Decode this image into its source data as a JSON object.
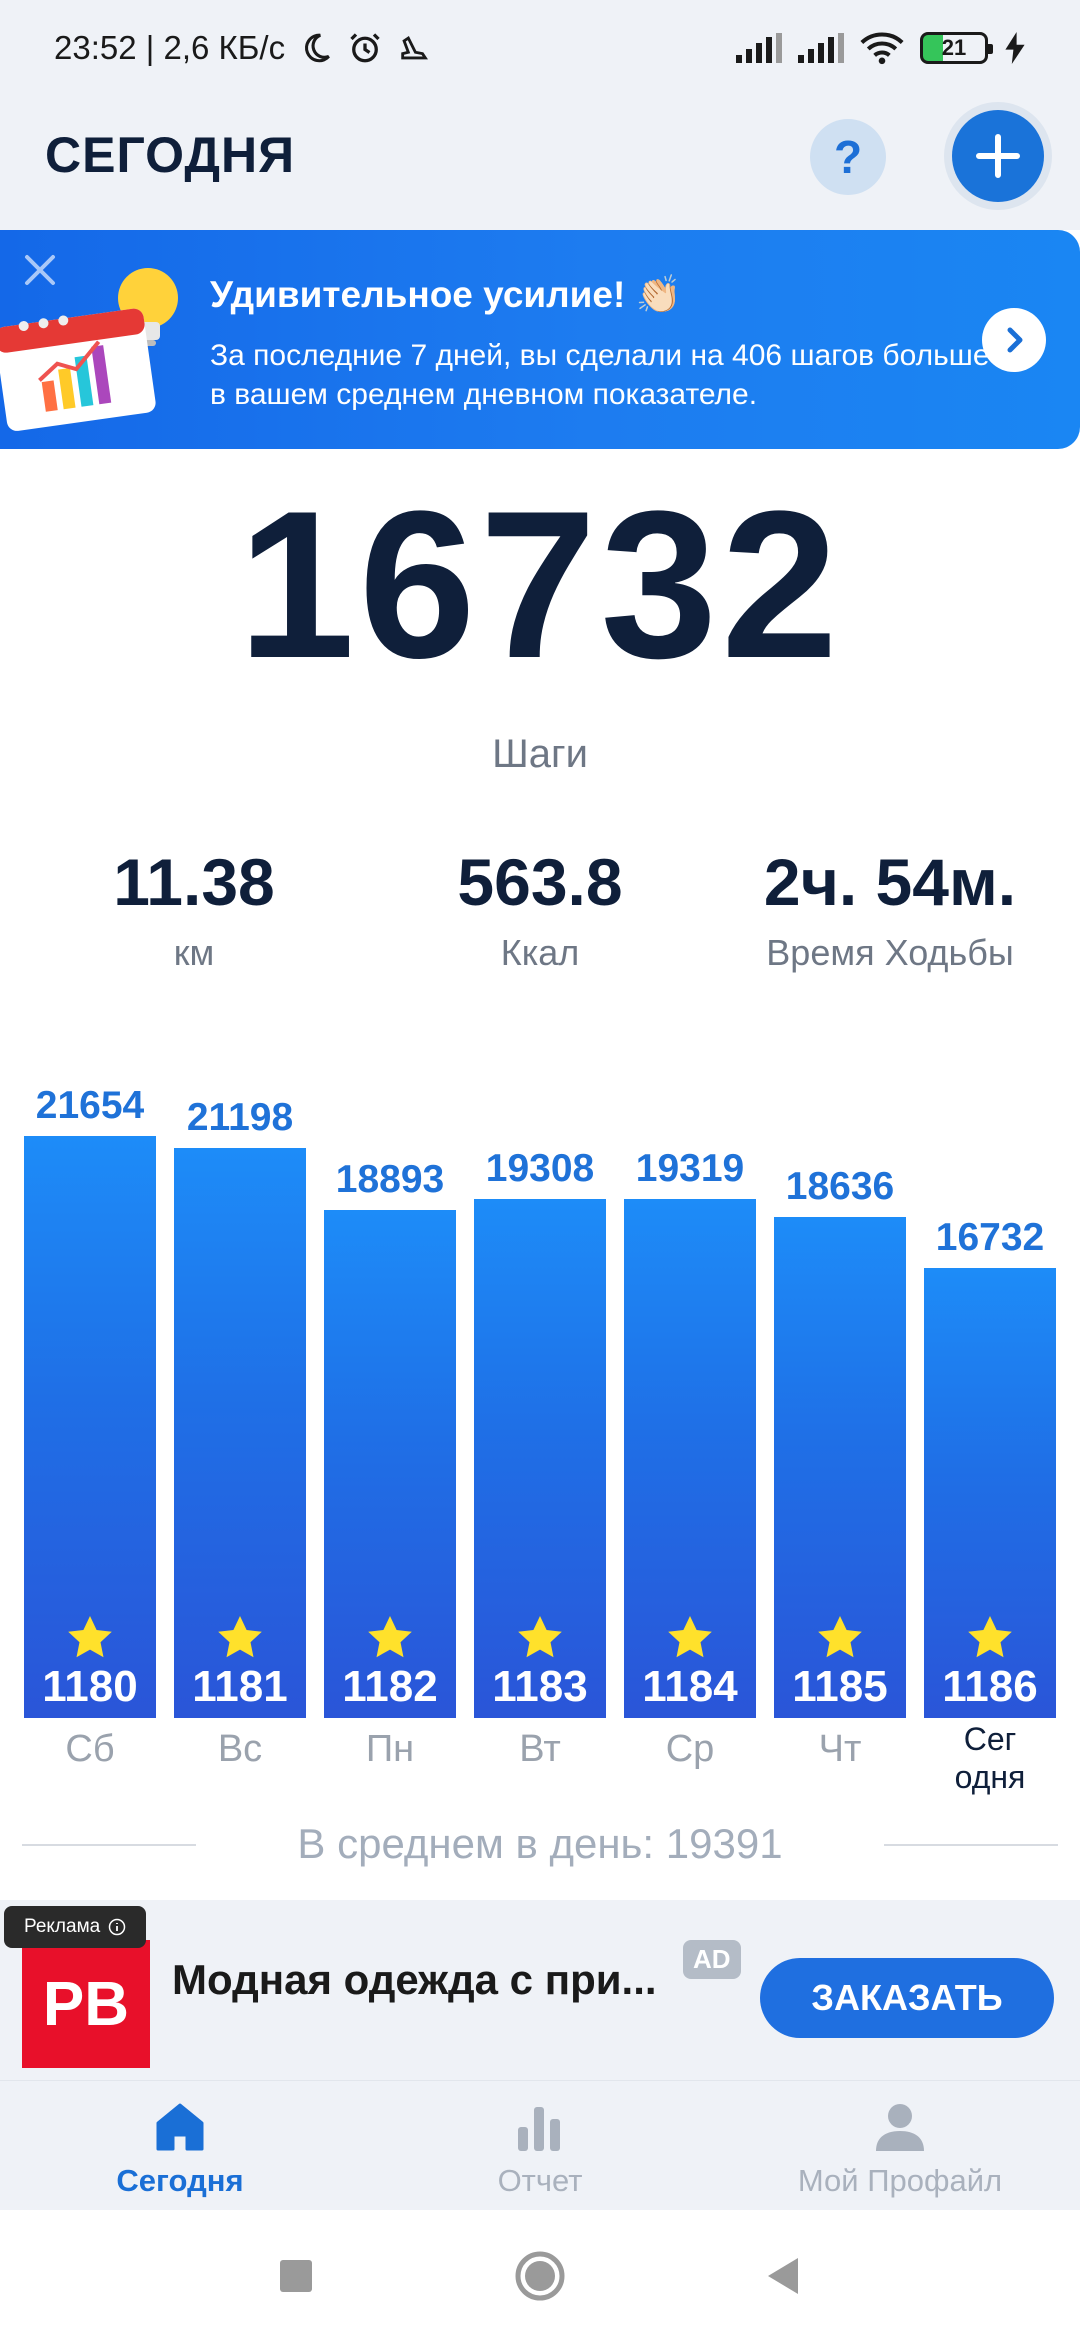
{
  "status_bar": {
    "time_and_speed": "23:52 | 2,6 КБ/с",
    "battery": "21"
  },
  "header": {
    "title": "СЕГОДНЯ",
    "help_label": "?"
  },
  "banner": {
    "title": "Удивительное усилие! 👏🏻",
    "text": "За последние 7 дней, вы сделали на 406 шагов больше в вашем среднем дневном показателе."
  },
  "today": {
    "steps": "16732",
    "steps_label": "Шаги",
    "distance": "11.38",
    "distance_unit": "км",
    "calories": "563.8",
    "calories_unit": "Ккал",
    "walk_time": "2ч. 54м.",
    "walk_time_label": "Время Ходьбы"
  },
  "chart_data": {
    "type": "bar",
    "categories": [
      "Сб",
      "Вс",
      "Пн",
      "Вт",
      "Ср",
      "Чт",
      "Сег одня"
    ],
    "values": [
      21654,
      21198,
      18893,
      19308,
      19319,
      18636,
      16732
    ],
    "rank_labels": [
      "1180",
      "1181",
      "1182",
      "1183",
      "1184",
      "1185",
      "1186"
    ],
    "highlight_last_category": true,
    "accent_color": "#1f72d8"
  },
  "average": {
    "text": "В среднем в день: 19391"
  },
  "ad": {
    "badge": "Реклама",
    "logo_text": "PB",
    "title": "Модная одежда с при...",
    "tag": "AD",
    "cta": "ЗАКАЗАТЬ",
    "logo_color": "#e8102a"
  },
  "bottom_nav": {
    "items": [
      {
        "label": "Сегодня",
        "icon": "home-icon",
        "active": true
      },
      {
        "label": "Отчет",
        "icon": "bar-chart-icon",
        "active": false
      },
      {
        "label": "Мой Профайл",
        "icon": "person-icon",
        "active": false
      }
    ]
  },
  "colors": {
    "primary": "#1a73d9",
    "header_bg": "#eff2f7",
    "text_dark": "#0f1f3a"
  }
}
